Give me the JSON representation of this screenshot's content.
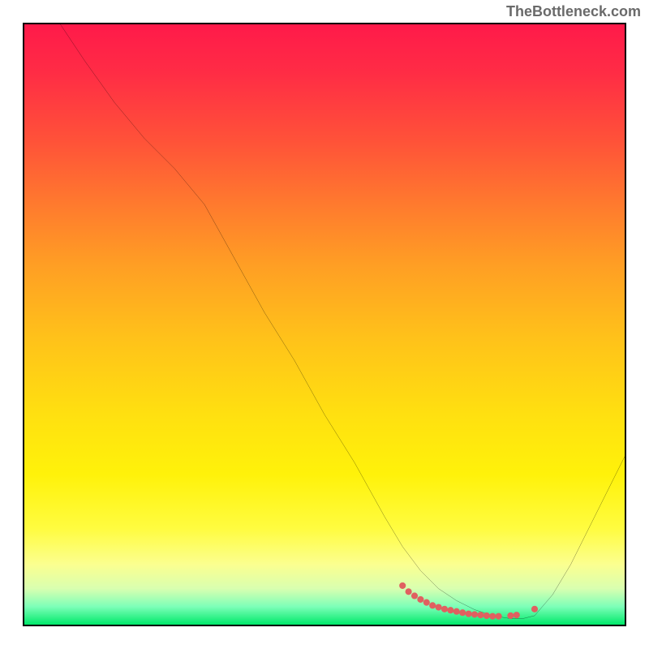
{
  "attribution": "TheBottleneck.com",
  "chart_data": {
    "type": "line",
    "title": "",
    "xlabel": "",
    "ylabel": "",
    "xlim": [
      0,
      100
    ],
    "ylim": [
      0,
      100
    ],
    "grid": false,
    "series": [
      {
        "name": "curve",
        "color": "#000000",
        "x": [
          6,
          10,
          15,
          20,
          25,
          30,
          35,
          40,
          45,
          50,
          55,
          60,
          63,
          66,
          69,
          72,
          75,
          78,
          81,
          83,
          85,
          88,
          91,
          94,
          97,
          100
        ],
        "y": [
          100,
          94,
          87,
          81,
          76,
          70,
          61,
          52,
          44,
          35,
          27,
          18,
          13,
          9,
          6,
          4,
          2.5,
          1.5,
          1,
          1,
          1.5,
          5,
          10,
          16,
          22,
          28
        ]
      }
    ],
    "markers": {
      "name": "highlight-points",
      "color": "#e06060",
      "points_x": [
        63,
        64,
        65,
        66,
        67,
        68,
        69,
        70,
        71,
        72,
        73,
        74,
        75,
        76,
        77,
        78,
        79,
        81,
        82,
        85
      ],
      "points_y": [
        6.5,
        5.5,
        4.8,
        4.2,
        3.7,
        3.2,
        2.9,
        2.6,
        2.4,
        2.2,
        2.0,
        1.8,
        1.7,
        1.6,
        1.5,
        1.4,
        1.4,
        1.5,
        1.6,
        2.6
      ]
    }
  }
}
